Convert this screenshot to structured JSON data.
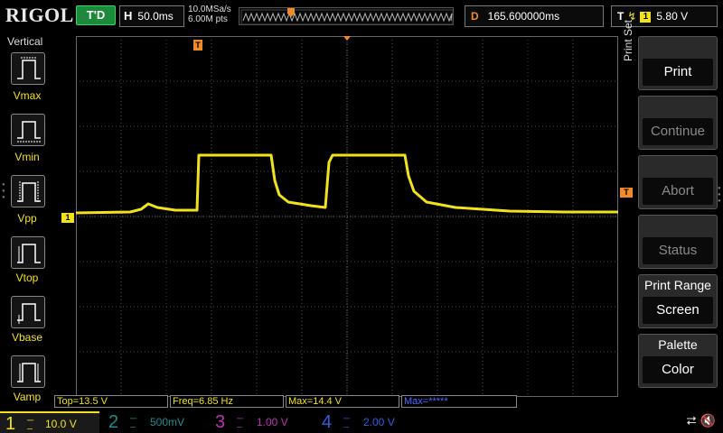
{
  "top": {
    "logo": "RIGOL",
    "run_state": "T'D",
    "horizontal_label": "H",
    "timebase": "50.0ms",
    "sample_rate": "10.0MSa/s",
    "memory_depth": "6.00M pts",
    "delay_label": "D",
    "delay_value": "165.600000ms",
    "trigger_label": "T",
    "trigger_edge_icon": "rising-edge-icon",
    "trigger_channel": "1",
    "trigger_level": "5.80 V"
  },
  "left_panel": {
    "title": "Vertical",
    "items": [
      {
        "label": "Vmax",
        "icon": "vmax-icon"
      },
      {
        "label": "Vmin",
        "icon": "vmin-icon"
      },
      {
        "label": "Vpp",
        "icon": "vpp-icon"
      },
      {
        "label": "Vtop",
        "icon": "vtop-icon"
      },
      {
        "label": "Vbase",
        "icon": "vbase-icon"
      },
      {
        "label": "Vamp",
        "icon": "vamp-icon"
      }
    ]
  },
  "markers": {
    "channel1": "1",
    "trigger_position": "T",
    "trigger_level": "T"
  },
  "right_menu": {
    "title": "Print Set",
    "buttons": [
      {
        "label": "Print",
        "enabled": true
      },
      {
        "label": "Continue",
        "enabled": false
      },
      {
        "label": "Abort",
        "enabled": false
      },
      {
        "label": "Status",
        "enabled": false
      },
      {
        "caption": "Print Range",
        "value": "Screen"
      },
      {
        "caption": "Palette",
        "value": "Color"
      }
    ]
  },
  "results": [
    "Top=13.5 V",
    "Freq=6.85 Hz",
    "Max=14.4 V",
    "Max=*****"
  ],
  "channels": [
    {
      "num": "1",
      "value": "10.0 V",
      "color": "#f2e21a",
      "active": true
    },
    {
      "num": "2",
      "value": "500mV",
      "color": "#1b8f8f",
      "active": false
    },
    {
      "num": "3",
      "value": "1.00 V",
      "color": "#c02fb8",
      "active": false
    },
    {
      "num": "4",
      "value": "2.00 V",
      "color": "#2f5fe0",
      "active": false
    }
  ],
  "status_icons": [
    "usb-icon",
    "speaker-muted-icon"
  ],
  "colors": {
    "ch1": "#f2e21a",
    "trigger": "#f08a2a",
    "run_state": "#1c8a3a",
    "grid": "#4a4a4a"
  }
}
